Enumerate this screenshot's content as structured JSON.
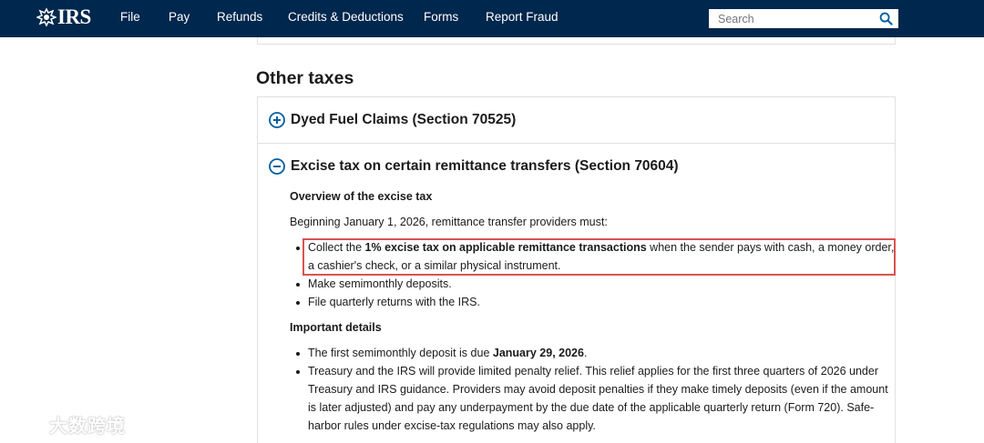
{
  "header": {
    "logo_text": "IRS",
    "nav": [
      "File",
      "Pay",
      "Refunds",
      "Credits & Deductions",
      "Forms",
      "Report Fraud"
    ],
    "search_placeholder": "Search"
  },
  "section": {
    "title": "Other taxes",
    "accordion": [
      {
        "title": "Dyed Fuel Claims (Section 70525)",
        "expanded": false
      },
      {
        "title": "Excise tax on certain remittance transfers (Section 70604)",
        "expanded": true
      }
    ],
    "overview_heading": "Overview of the excise tax",
    "intro": "Beginning January 1, 2026, remittance transfer providers must:",
    "must_items": {
      "collect": {
        "pre": "Collect the ",
        "bold": "1% excise tax on applicable remittance transactions",
        "post_line1": " when the sender pays with cash, a money order,",
        "line2": "a cashier's check, or a similar physical instrument."
      },
      "deposits": "Make semimonthly deposits.",
      "returns": "File quarterly returns with the IRS."
    },
    "details_heading": "Important details",
    "details": {
      "first_deposit_pre": "The first semimonthly deposit is due ",
      "first_deposit_bold": "January 29, 2026",
      "first_deposit_post": ".",
      "relief_lines": [
        "Treasury and the IRS will provide limited penalty relief. This relief applies for the first three quarters of 2026 under",
        "Treasury and IRS guidance. Providers may avoid deposit penalties if they make timely deposits (even if the amount",
        "is later adjusted) and pay any underpayment by the due date of the applicable quarterly return (Form 720). Safe-",
        "harbor rules under excise-tax regulations may also apply."
      ]
    }
  },
  "watermark": {
    "text": "大数跨境"
  },
  "colors": {
    "header_bg": "#00274d",
    "accent_blue": "#005ea2",
    "highlight": "#d9534f"
  }
}
